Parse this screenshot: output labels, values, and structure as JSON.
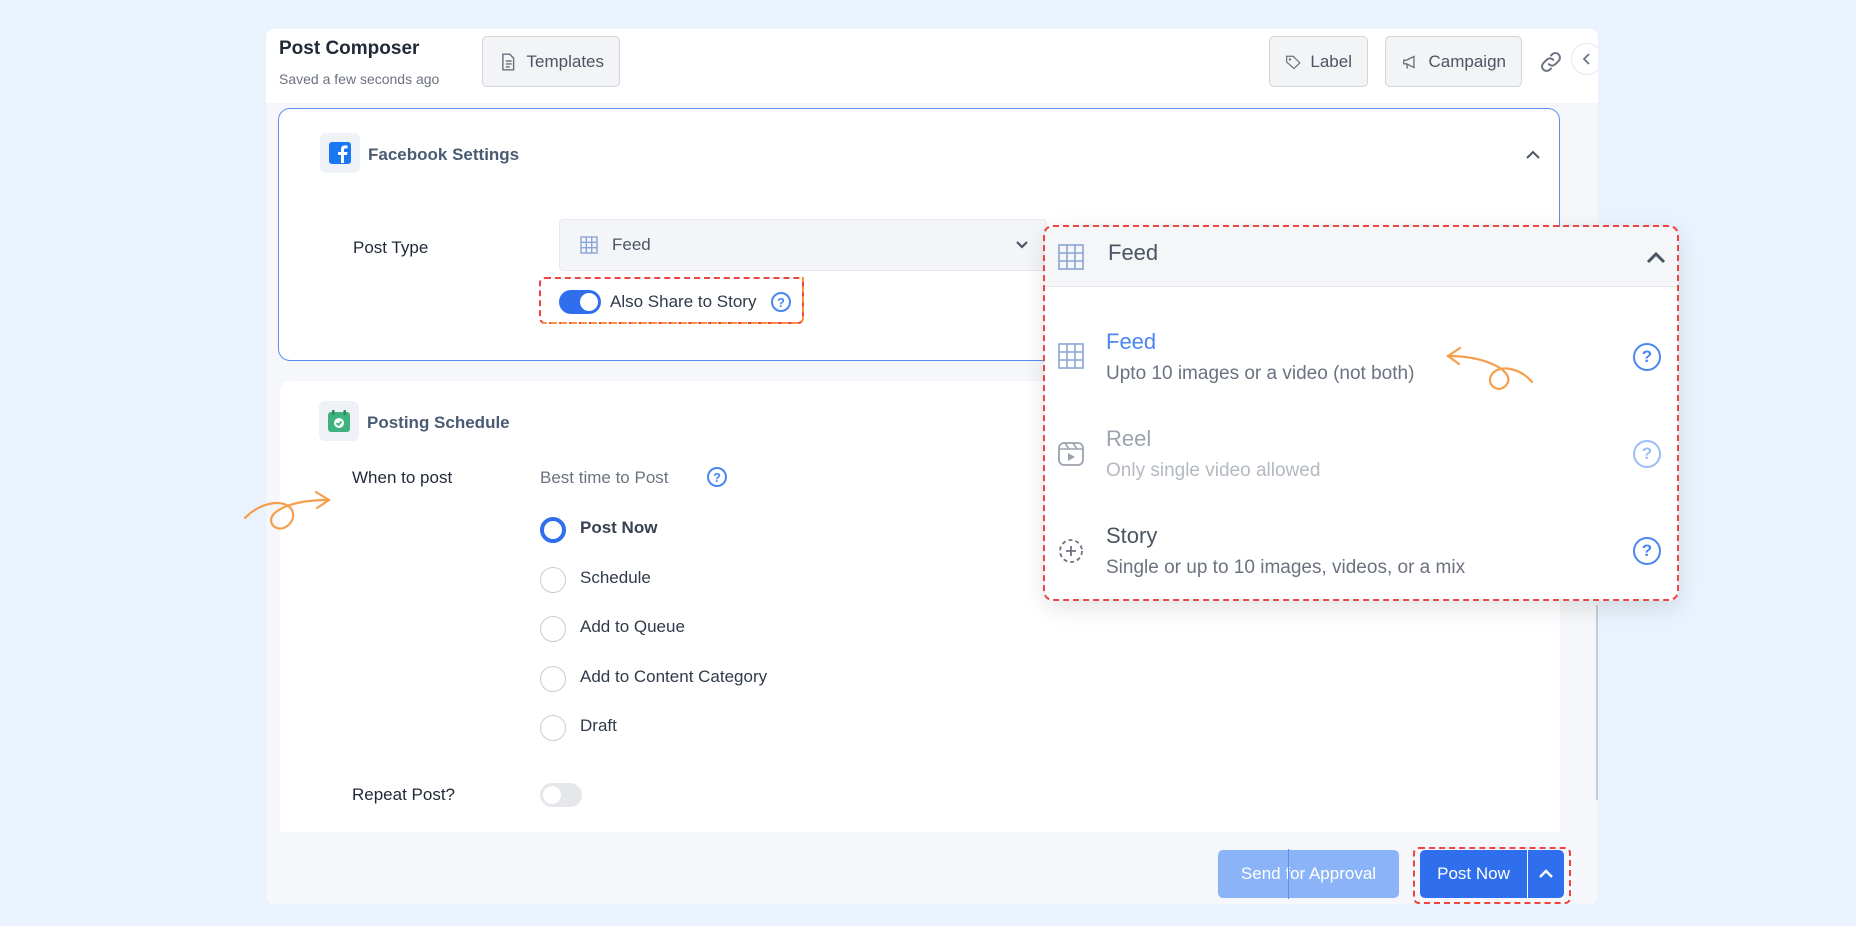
{
  "header": {
    "title": "Post Composer",
    "subtitle": "Saved a few seconds ago",
    "templates_label": "Templates",
    "label_label": "Label",
    "campaign_label": "Campaign"
  },
  "facebook": {
    "section_title": "Facebook Settings",
    "post_type_label": "Post Type",
    "post_type_value": "Feed",
    "share_story_label": "Also Share to Story",
    "share_story_on": true
  },
  "schedule": {
    "section_title": "Posting Schedule",
    "when_label": "When to post",
    "best_time_label": "Best time to Post",
    "options": [
      {
        "label": "Post Now",
        "selected": true
      },
      {
        "label": "Schedule",
        "selected": false
      },
      {
        "label": "Add to Queue",
        "selected": false
      },
      {
        "label": "Add to Content Category",
        "selected": false
      },
      {
        "label": "Draft",
        "selected": false
      }
    ],
    "repeat_label": "Repeat Post?",
    "repeat_on": false
  },
  "footer": {
    "approval_label": "Send for Approval",
    "post_label": "Post Now"
  },
  "dropdown": {
    "selected_label": "Feed",
    "items": [
      {
        "title": "Feed",
        "desc": "Upto 10 images or a video (not both)",
        "icon": "grid-icon",
        "active": true
      },
      {
        "title": "Reel",
        "desc": "Only single video allowed",
        "icon": "reel-icon",
        "active": false
      },
      {
        "title": "Story",
        "desc": "Single or up to 10 images, videos, or a mix",
        "icon": "story-add-icon",
        "active": false
      }
    ]
  },
  "colors": {
    "primary": "#2f6fee",
    "primary_light": "#8bb4f8",
    "active_item": "#4b86f2",
    "annotation_red": "#ef4444",
    "annotation_orange": "#fb923c",
    "background": "#eaf3fd"
  }
}
